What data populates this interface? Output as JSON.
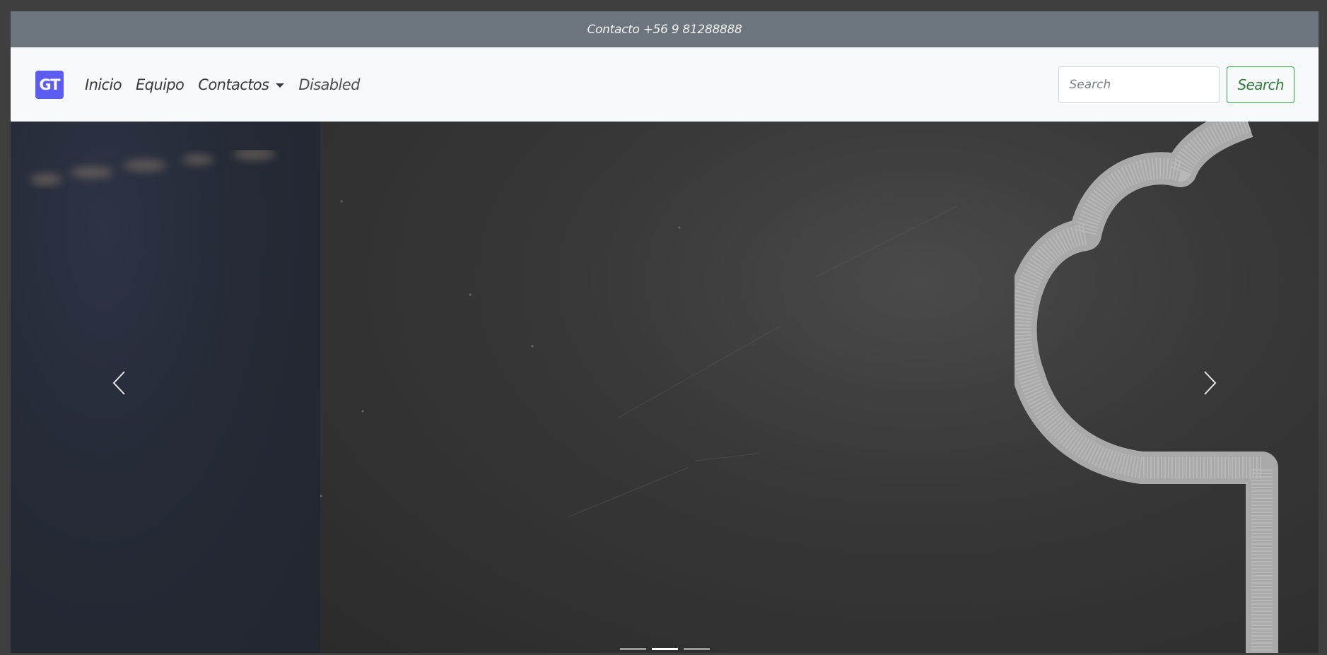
{
  "topbar": {
    "contact_text": "Contacto +56 9 81288888"
  },
  "navbar": {
    "brand_text": "GT",
    "brand_color": "#5c5cf2",
    "links": [
      {
        "label": "Inicio"
      },
      {
        "label": "Equipo"
      },
      {
        "label": "Contactos",
        "has_dropdown": true
      },
      {
        "label": "Disabled",
        "disabled": true
      }
    ],
    "search": {
      "placeholder": "Search",
      "value": "",
      "button_label": "Search",
      "button_color": "#28a745"
    }
  },
  "carousel": {
    "active_index": 1,
    "indicator_count": 3,
    "prev_icon": "chevron-left-icon",
    "next_icon": "chevron-right-icon"
  }
}
